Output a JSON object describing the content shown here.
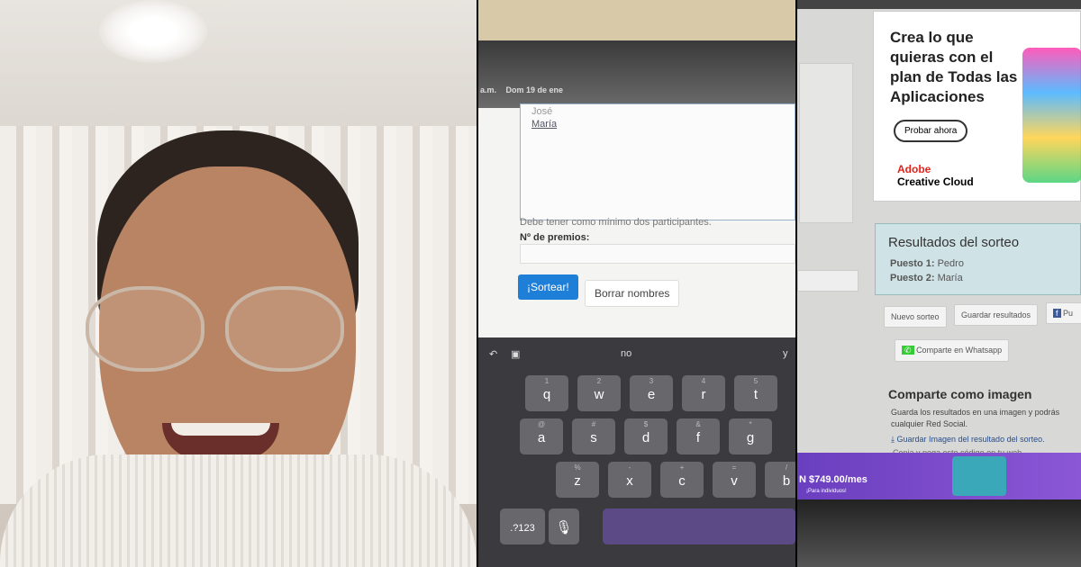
{
  "tablet_form": {
    "status_time_partial": "a.m.",
    "status_date": "Dom 19 de ene",
    "participant_partial": "José",
    "participant_last": "María",
    "hint": "Debe tener como mínimo dos participantes.",
    "prizes_label": "Nº de premios:",
    "draw_button": "¡Sortear!",
    "clear_button": "Borrar nombres",
    "accent_color": "#1e7fd8"
  },
  "keyboard": {
    "suggestion": "no",
    "suggestion_right": "y",
    "row1": [
      {
        "k": "q",
        "alt": "1"
      },
      {
        "k": "w",
        "alt": "2"
      },
      {
        "k": "e",
        "alt": "3"
      },
      {
        "k": "r",
        "alt": "4"
      },
      {
        "k": "t",
        "alt": "5"
      }
    ],
    "row2": [
      {
        "k": "a",
        "alt": "@"
      },
      {
        "k": "s",
        "alt": "#"
      },
      {
        "k": "d",
        "alt": "$"
      },
      {
        "k": "f",
        "alt": "&"
      },
      {
        "k": "g",
        "alt": "*"
      }
    ],
    "row3": [
      {
        "k": "z",
        "alt": "%"
      },
      {
        "k": "x",
        "alt": "-"
      },
      {
        "k": "c",
        "alt": "+"
      },
      {
        "k": "v",
        "alt": "="
      },
      {
        "k": "b",
        "alt": "/"
      }
    ],
    "numbers_key": ".?123"
  },
  "results_page": {
    "ad_headline": "Crea lo que quieras con el plan de Todas las Aplicaciones",
    "ad_button": "Probar ahora",
    "ad_brand_1": "Adobe",
    "ad_brand_2": "Creative Cloud",
    "results_title": "Resultados del sorteo",
    "place1_label": "Puesto 1:",
    "place1_value": "Pedro",
    "place2_label": "Puesto 2:",
    "place2_value": "María",
    "new_draw": "Nuevo sorteo",
    "save_results": "Guardar resultados",
    "facebook_partial": "Pu",
    "whatsapp": "Comparte en Whatsapp",
    "share_image_title": "Comparte como imagen",
    "share_image_text": "Guarda los resultados en una imagen y podrás cualquier Red Social.",
    "save_image_link": "Guardar Imagen del resultado del sorteo.",
    "copy_code_partial": "Copia y pega este código en tu web",
    "promo_price": "N $749.00/mes",
    "promo_sub": "¡Para individuos!"
  }
}
